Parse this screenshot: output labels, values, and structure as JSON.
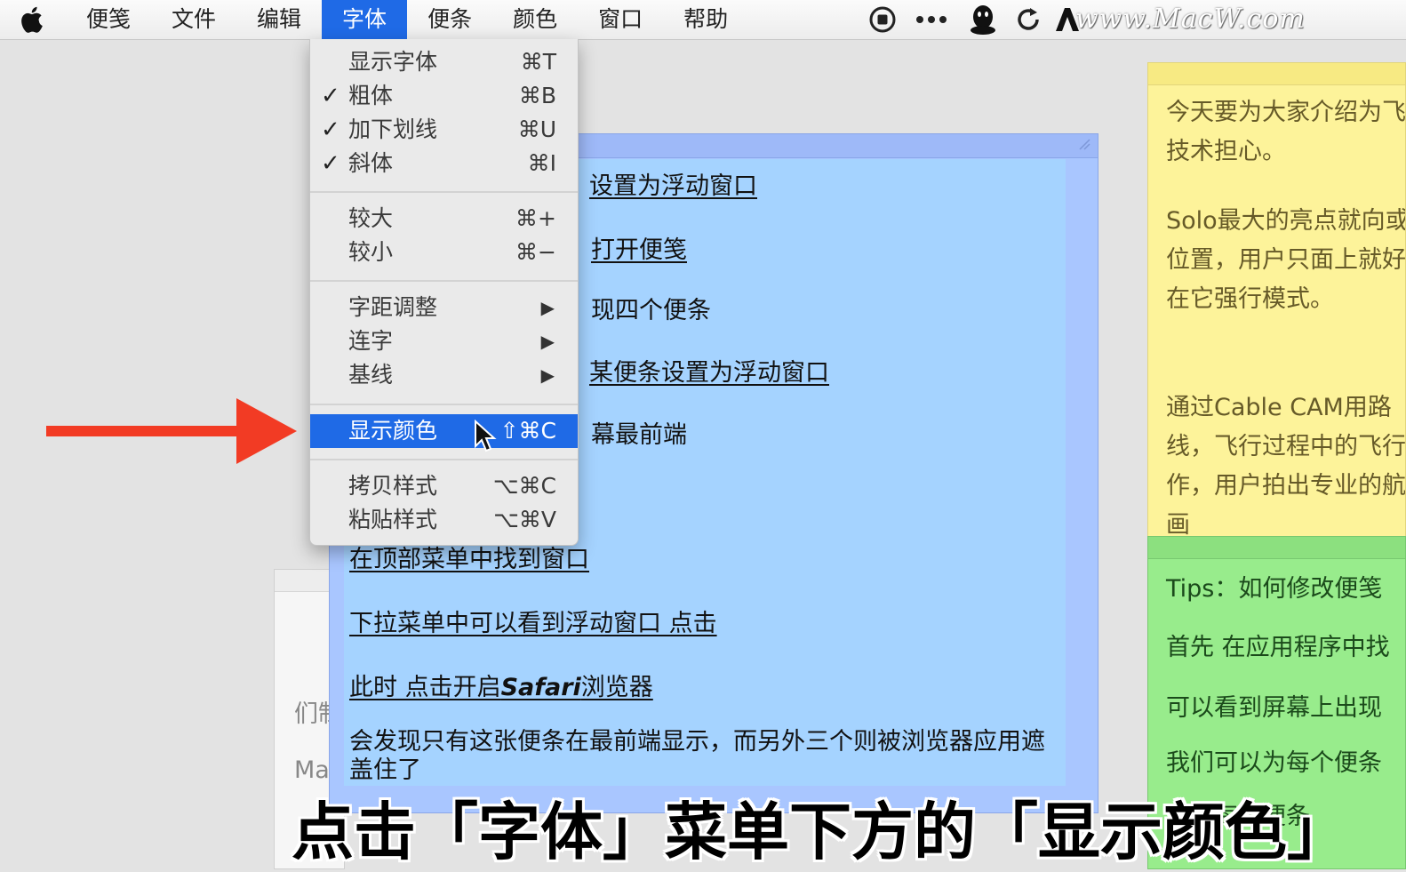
{
  "menubar": {
    "items": [
      "便笺",
      "文件",
      "编辑",
      "字体",
      "便条",
      "颜色",
      "窗口",
      "帮助"
    ],
    "active_index": 3
  },
  "watermark": "www.MacW.com",
  "font_menu": {
    "items": [
      {
        "label": "显示字体",
        "shortcut": "⌘T",
        "checked": false
      },
      {
        "label": "粗体",
        "shortcut": "⌘B",
        "checked": true
      },
      {
        "label": "加下划线",
        "shortcut": "⌘U",
        "checked": true
      },
      {
        "label": "斜体",
        "shortcut": "⌘I",
        "checked": true
      },
      {
        "label": "较大",
        "shortcut": "⌘+"
      },
      {
        "label": "较小",
        "shortcut": "⌘−"
      },
      {
        "label": "字距调整",
        "submenu": true
      },
      {
        "label": "连字",
        "submenu": true
      },
      {
        "label": "基线",
        "submenu": true
      },
      {
        "label": "显示颜色",
        "shortcut": "⇧⌘C",
        "highlighted": true
      },
      {
        "label": "拷贝样式",
        "shortcut": "⌥⌘C"
      },
      {
        "label": "粘贴样式",
        "shortcut": "⌥⌘V"
      }
    ]
  },
  "blue_note": {
    "lines": [
      "设置为浮动窗口",
      "打开便笺",
      "现四个便条",
      "某便条设置为浮动窗口",
      "幕最前端",
      "在顶部菜单中找到窗口",
      "下拉菜单中可以看到浮动窗口 点击",
      "此时 点击开启Safari浏览器",
      "会发现只有这张便条在最前端显示，而另外三个则被浏览器应用遮盖住了"
    ],
    "italic_word": "Safari"
  },
  "white_note": {
    "fragments": [
      "们制",
      "Ma"
    ]
  },
  "yellow_note": {
    "paragraphs": [
      "今天要为大家介绍为飞行技术担心。",
      "Solo最大的亮点就向或位置，用户只面上就好。在它强行模式。",
      "通过Cable CAM用路线，飞行过程中的飞行操作，用户拍出专业的航拍画"
    ]
  },
  "green_note": {
    "lines": [
      "Tips：如何修改便笺",
      "首先 在应用程序中找",
      "可以看到屏幕上出现",
      "我们可以为每个便条",
      "请在每个便条"
    ]
  },
  "caption": "点击「字体」菜单下方的「显示颜色」",
  "colors": {
    "highlight": "#1f6ae6",
    "arrow": "#f23b24",
    "blue_note": "#a5d3ff",
    "yellow_note": "#fdf39a",
    "green_note": "#98ec8c"
  },
  "icons": [
    "apple-logo-icon",
    "record-icon",
    "more-icon",
    "qq-icon",
    "sync-icon",
    "adobe-icon",
    "red-arrow-icon",
    "mouse-cursor-icon"
  ]
}
